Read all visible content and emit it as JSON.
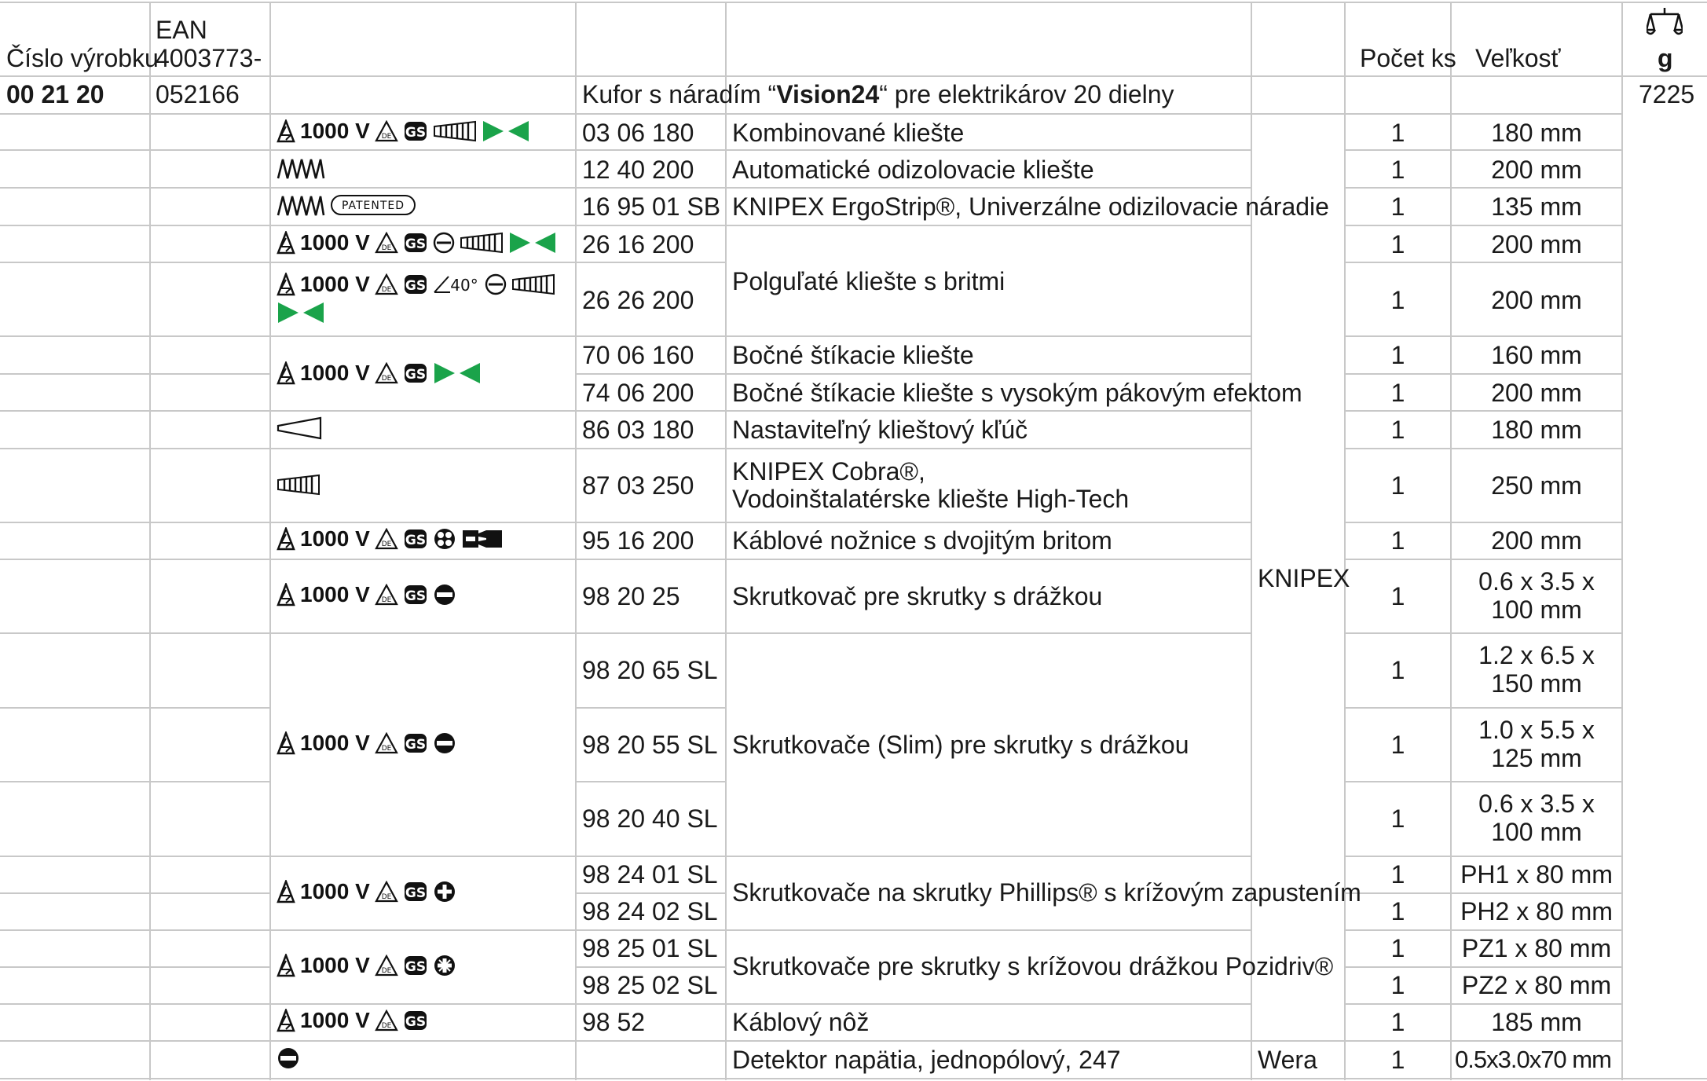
{
  "header": {
    "product_no": "Číslo výrobku",
    "ean_line1": "EAN",
    "ean_line2": "4003773-",
    "qty": "Počet ks",
    "size": "Veľkosť",
    "weight_unit": "g"
  },
  "set": {
    "product_no": "00 21 20",
    "ean": "052166",
    "desc_prefix": "Kufor s náradím “",
    "desc_bold": "Vision24",
    "desc_suffix": "“ pre elektrikárov 20 dielny",
    "weight": "7225"
  },
  "symbols": {
    "voltage": "1000 V",
    "patented": "PATENTED",
    "angle": "40°"
  },
  "brands": {
    "knipex": "KNIPEX",
    "wera": "Wera"
  },
  "rows": [
    {
      "code": "03 06 180",
      "qty": "1",
      "size": "180 mm"
    },
    {
      "code": "12 40 200",
      "qty": "1",
      "size": "200 mm"
    },
    {
      "code": "16 95 01 SB",
      "qty": "1",
      "size": "135 mm"
    },
    {
      "code": "26 16 200",
      "qty": "1",
      "size": "200 mm"
    },
    {
      "code": "26 26 200",
      "qty": "1",
      "size": "200 mm"
    },
    {
      "code": "70 06 160",
      "qty": "1",
      "size": "160 mm"
    },
    {
      "code": "74 06 200",
      "qty": "1",
      "size": "200 mm"
    },
    {
      "code": "86 03 180",
      "qty": "1",
      "size": "180 mm"
    },
    {
      "code": "87 03 250",
      "qty": "1",
      "size": "250 mm"
    },
    {
      "code": "95 16 200",
      "qty": "1",
      "size": "200 mm"
    },
    {
      "code": "98 20 25",
      "qty": "1",
      "size": "0.6 x 3.5 x 100 mm"
    },
    {
      "code": "98 20 65 SL",
      "qty": "1",
      "size": "1.2 x 6.5 x 150 mm"
    },
    {
      "code": "98 20 55 SL",
      "qty": "1",
      "size": "1.0 x 5.5 x 125 mm"
    },
    {
      "code": "98 20 40 SL",
      "qty": "1",
      "size": "0.6 x 3.5 x 100 mm"
    },
    {
      "code": "98 24 01 SL",
      "qty": "1",
      "size": "PH1 x 80 mm"
    },
    {
      "code": "98 24 02 SL",
      "qty": "1",
      "size": "PH2 x 80 mm"
    },
    {
      "code": "98 25 01 SL",
      "qty": "1",
      "size": "PZ1 x 80 mm"
    },
    {
      "code": "98 25 02 SL",
      "qty": "1",
      "size": "PZ2 x 80 mm"
    },
    {
      "code": "98 52",
      "qty": "1",
      "size": "185 mm"
    },
    {
      "code": "",
      "qty": "1",
      "size": "0.5x3.0x70 mm"
    }
  ],
  "descriptions": [
    "Kombinované kliešte",
    "Automatické odizolovacie kliešte",
    "KNIPEX ErgoStrip®, Univerzálne odizilovacie náradie",
    "Polguľaté kliešte s britmi",
    "Bočné štíkacie kliešte",
    "Bočné štíkacie kliešte s vysokým pákovým efektom",
    "Nastaviteľný klieštový kľúč",
    "KNIPEX Cobra®,",
    "Vodoinštalatérske kliešte High-Tech",
    "Káblové nožnice s dvojitým britom",
    "Skrutkovač pre skrutky s drážkou",
    "Skrutkovače (Slim) pre skrutky s drážkou",
    "Skrutkovače na skrutky Phillips® s krížovým zapustením",
    "Skrutkovače pre skrutky s krížovou drážkou Pozidriv®",
    "Káblový nôž",
    "Detektor napätia, jednopólový, 247"
  ],
  "colors": {
    "grid": "#c8c8c8",
    "green": "#1aa34a",
    "text": "#1a1a1a"
  }
}
